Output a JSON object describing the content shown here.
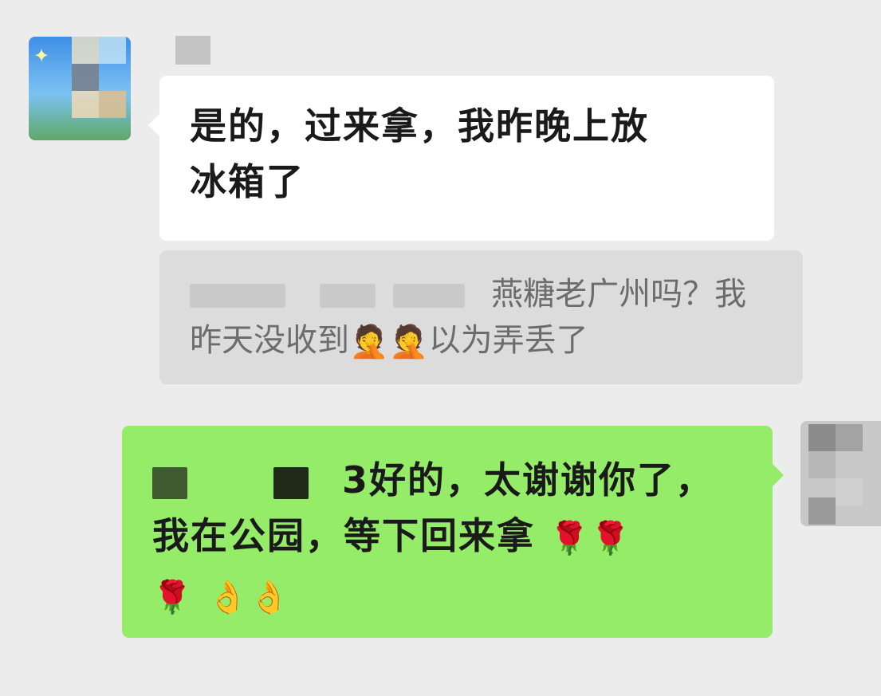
{
  "messages": {
    "incoming": {
      "line1": "是的，过来拿，我昨晚上放",
      "line2": "冰箱了"
    },
    "quote": {
      "line1_visible": "燕糖老广州吗？我",
      "line2_start": "昨天没收到",
      "line2_emoji": "🤦",
      "line2_end": "以为弄丢了"
    },
    "outgoing": {
      "line1_visible": "3好的，太谢谢你了，",
      "line2": "我在公园，等下回来拿",
      "rose_emoji": "🌹",
      "hands_emoji": "👌"
    }
  },
  "avatar_left_icon": "sparkle-icon"
}
